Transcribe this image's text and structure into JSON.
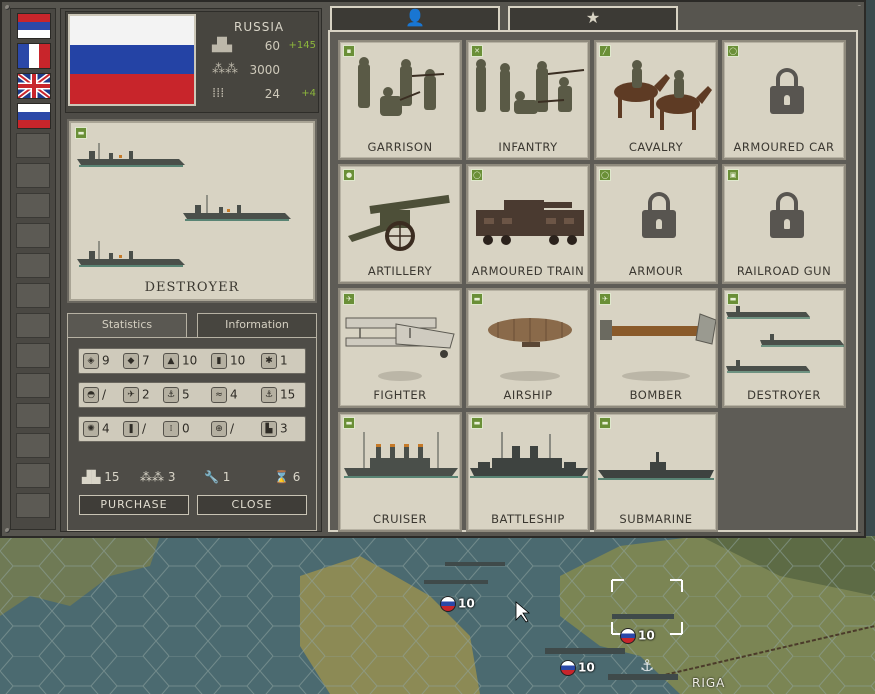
{
  "nation": {
    "name": "RUSSIA",
    "resources": [
      {
        "icon": "factory-icon",
        "value": "60",
        "delta": "+145"
      },
      {
        "icon": "manpower-icon",
        "value": "3000",
        "delta": ""
      },
      {
        "icon": "ammo-icon",
        "value": "24",
        "delta": "+4"
      }
    ]
  },
  "flags": [
    {
      "name": "serbia",
      "active": false
    },
    {
      "name": "france",
      "active": false
    },
    {
      "name": "united-kingdom",
      "active": false
    },
    {
      "name": "russia",
      "active": true
    }
  ],
  "preview": {
    "title": "DESTROYER"
  },
  "tabs": {
    "statistics": "Statistics",
    "information": "Information"
  },
  "stats": {
    "row1": [
      "9",
      "7",
      "10",
      "10",
      "1"
    ],
    "row2": [
      "/",
      "2",
      "5",
      "4",
      "15"
    ],
    "row3": [
      "4",
      "/",
      "0",
      "/",
      "3"
    ],
    "cost": {
      "industry": "15",
      "manpower": "3",
      "upkeep": "1",
      "turns": "6"
    }
  },
  "buttons": {
    "purchase": "PURCHASE",
    "close": "CLOSE"
  },
  "right_tabs": [
    {
      "icon": "soldier-icon",
      "symbol": "👤"
    },
    {
      "icon": "star-icon",
      "symbol": "★"
    }
  ],
  "units": [
    {
      "label": "GARRISON",
      "locked": false
    },
    {
      "label": "INFANTRY",
      "locked": false
    },
    {
      "label": "CAVALRY",
      "locked": false
    },
    {
      "label": "ARMOURED CAR",
      "locked": true
    },
    {
      "label": "ARTILLERY",
      "locked": false
    },
    {
      "label": "ARMOURED TRAIN",
      "locked": false
    },
    {
      "label": "ARMOUR",
      "locked": true
    },
    {
      "label": "RAILROAD GUN",
      "locked": true
    },
    {
      "label": "FIGHTER",
      "locked": false
    },
    {
      "label": "AIRSHIP",
      "locked": false
    },
    {
      "label": "BOMBER",
      "locked": false
    },
    {
      "label": "DESTROYER",
      "locked": false
    },
    {
      "label": "CRUISER",
      "locked": false
    },
    {
      "label": "BATTLESHIP",
      "locked": false
    },
    {
      "label": "SUBMARINE",
      "locked": false
    }
  ],
  "map": {
    "city": "RIGA",
    "unit_strengths": [
      "10",
      "10",
      "10"
    ]
  }
}
